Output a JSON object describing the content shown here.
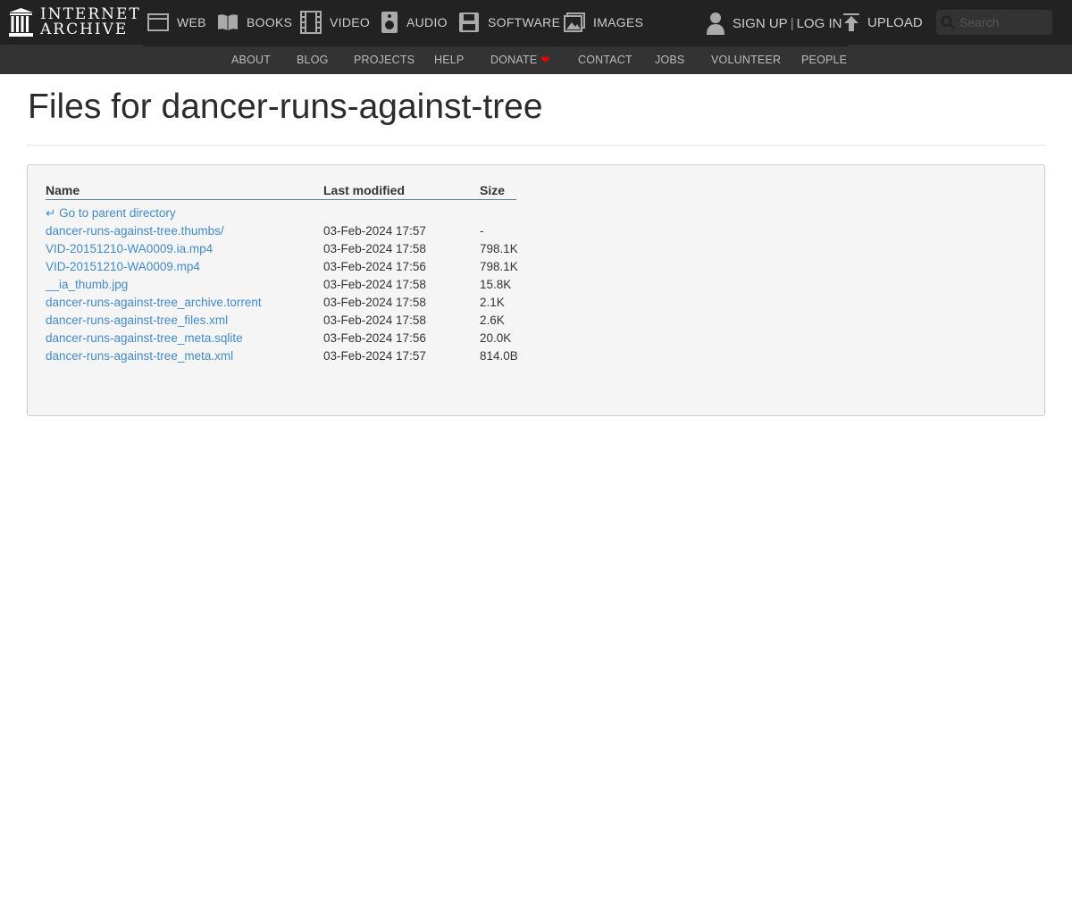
{
  "header": {
    "logo_line1": "INTERNET",
    "logo_line2": "ARCHIVE",
    "mediatypes": [
      {
        "label": "WEB",
        "icon": "web-icon"
      },
      {
        "label": "BOOKS",
        "icon": "book-icon"
      },
      {
        "label": "VIDEO",
        "icon": "film-icon"
      },
      {
        "label": "AUDIO",
        "icon": "speaker-icon"
      },
      {
        "label": "SOFTWARE",
        "icon": "floppy-icon"
      },
      {
        "label": "IMAGES",
        "icon": "image-icon"
      }
    ],
    "signup": "SIGN UP",
    "separator": "|",
    "login": "LOG IN",
    "upload": "UPLOAD",
    "search_placeholder": "Search"
  },
  "subnav": [
    "ABOUT",
    "BLOG",
    "PROJECTS",
    "HELP",
    "DONATE",
    "CONTACT",
    "JOBS",
    "VOLUNTEER",
    "PEOPLE"
  ],
  "page_title": "Files for dancer-runs-against-tree",
  "table": {
    "headers": {
      "name": "Name",
      "modified": "Last modified",
      "size": "Size"
    },
    "parent_link": "Go to parent directory",
    "rows": [
      {
        "name": "dancer-runs-against-tree.thumbs/",
        "modified": "03-Feb-2024 17:57",
        "size": "-"
      },
      {
        "name": "VID-20151210-WA0009.ia.mp4",
        "modified": "03-Feb-2024 17:58",
        "size": "798.1K"
      },
      {
        "name": "VID-20151210-WA0009.mp4",
        "modified": "03-Feb-2024 17:56",
        "size": "798.1K"
      },
      {
        "name": "__ia_thumb.jpg",
        "modified": "03-Feb-2024 17:58",
        "size": "15.8K"
      },
      {
        "name": "dancer-runs-against-tree_archive.torrent",
        "modified": "03-Feb-2024 17:58",
        "size": "2.1K"
      },
      {
        "name": "dancer-runs-against-tree_files.xml",
        "modified": "03-Feb-2024 17:58",
        "size": "2.6K"
      },
      {
        "name": "dancer-runs-against-tree_meta.sqlite",
        "modified": "03-Feb-2024 17:56",
        "size": "20.0K"
      },
      {
        "name": "dancer-runs-against-tree_meta.xml",
        "modified": "03-Feb-2024 17:57",
        "size": "814.0B"
      }
    ]
  },
  "colors": {
    "topbar": "#222222",
    "subbar": "#333333",
    "link": "#428bca",
    "heart": "#ee0000"
  }
}
